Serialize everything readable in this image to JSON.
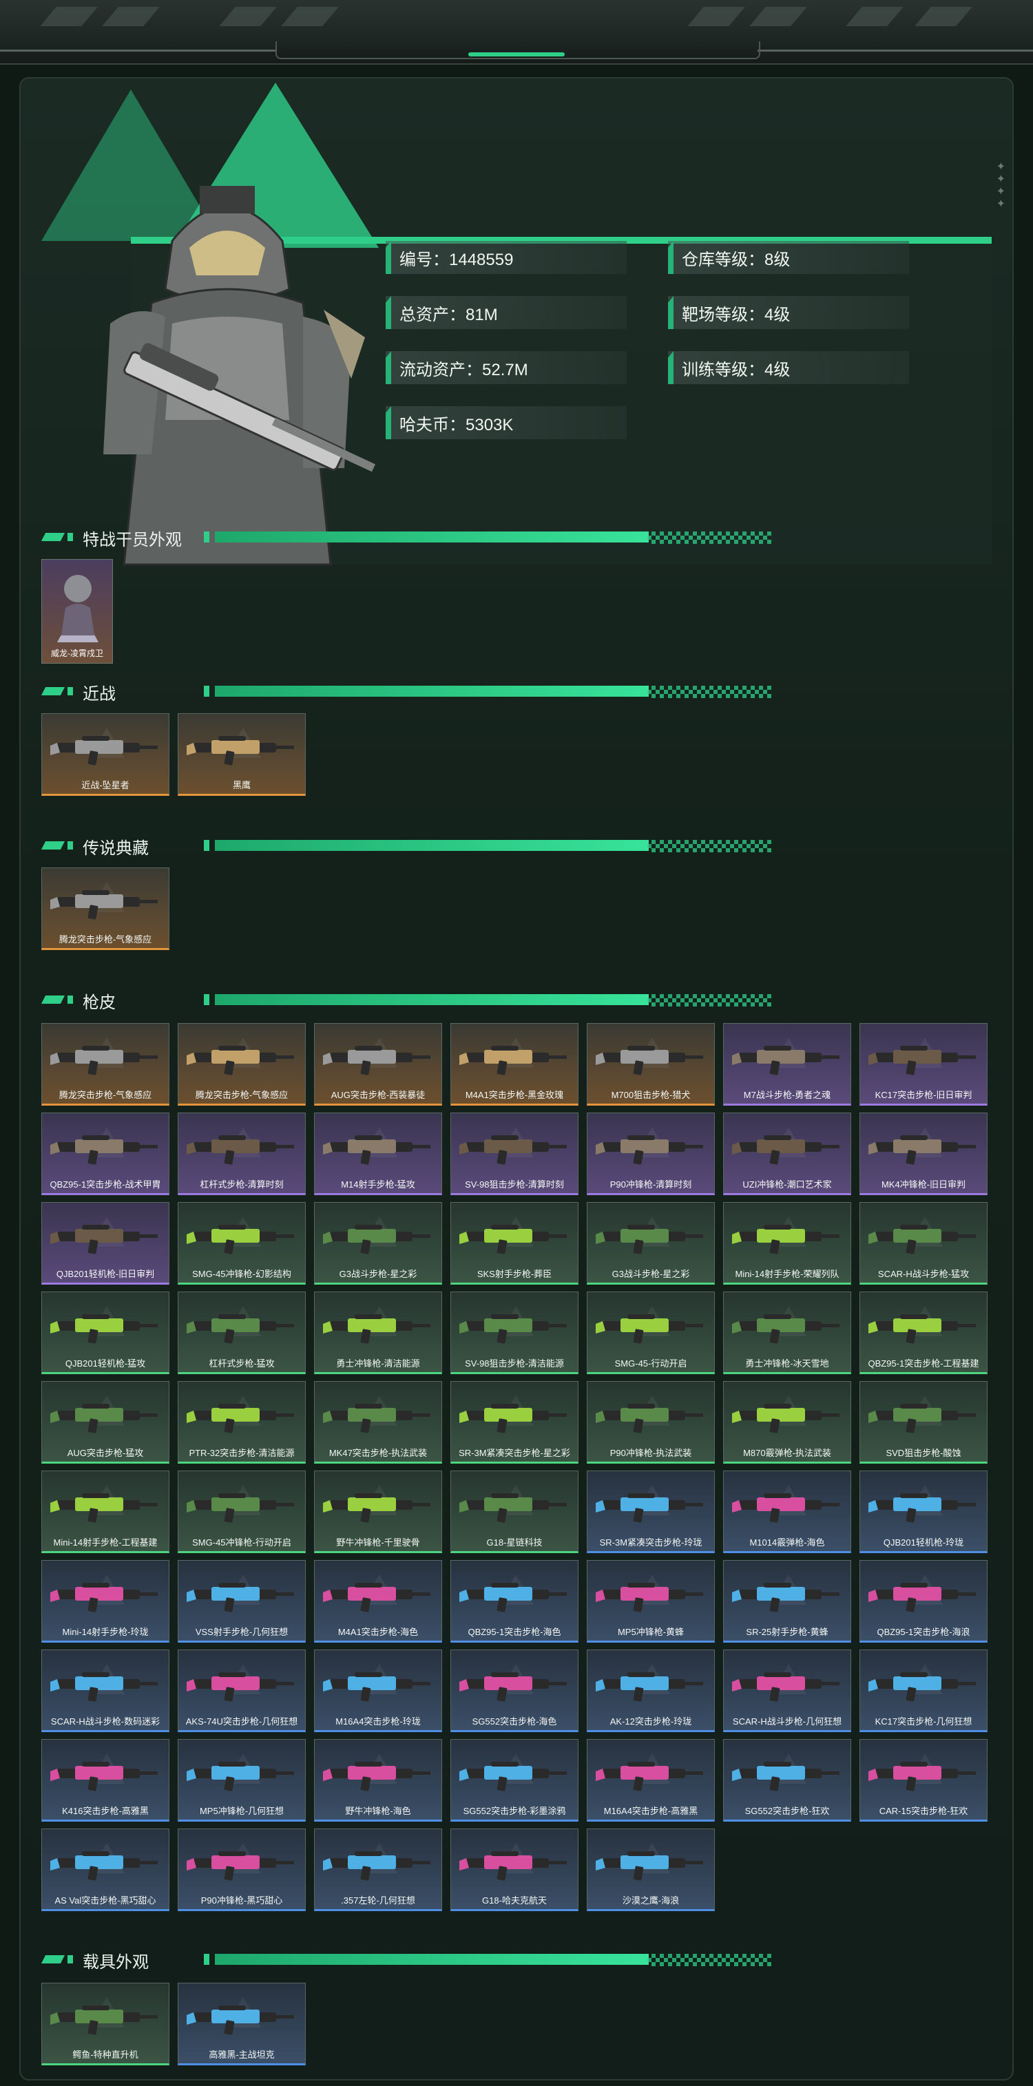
{
  "profile": {
    "stats": [
      {
        "label": "编号：1448559"
      },
      {
        "label": "仓库等级：8级"
      },
      {
        "label": "总资产：81M"
      },
      {
        "label": "靶场等级：4级"
      },
      {
        "label": "流动资产：52.7M"
      },
      {
        "label": "训练等级：4级"
      },
      {
        "label": "哈夫币：5303K"
      }
    ]
  },
  "sections": {
    "operator": {
      "title": "特战干员外观",
      "items": [
        {
          "name": "威龙-凌霄戍卫",
          "tier": "purple"
        }
      ]
    },
    "melee": {
      "title": "近战",
      "items": [
        {
          "name": "近战-坠星者",
          "tier": "gold"
        },
        {
          "name": "黑鹰",
          "tier": "gold"
        }
      ]
    },
    "legend": {
      "title": "传说典藏",
      "items": [
        {
          "name": "腾龙突击步枪-气象感应",
          "tier": "gold"
        }
      ]
    },
    "skins": {
      "title": "枪皮",
      "items": [
        {
          "name": "腾龙突击步枪-气象感应",
          "tier": "gold"
        },
        {
          "name": "腾龙突击步枪-气象感应",
          "tier": "gold"
        },
        {
          "name": "AUG突击步枪-西装暴徒",
          "tier": "gold"
        },
        {
          "name": "M4A1突击步枪-黑金玫瑰",
          "tier": "gold"
        },
        {
          "name": "M700狙击步枪-猎犬",
          "tier": "gold"
        },
        {
          "name": "M7战斗步枪-勇者之魂",
          "tier": "purple"
        },
        {
          "name": "KC17突击步枪-旧日审判",
          "tier": "purple"
        },
        {
          "name": "QBZ95-1突击步枪-战术甲胄",
          "tier": "purple"
        },
        {
          "name": "杠杆式步枪-清算时刻",
          "tier": "purple"
        },
        {
          "name": "M14射手步枪-猛攻",
          "tier": "purple"
        },
        {
          "name": "SV-98狙击步枪-清算时刻",
          "tier": "purple"
        },
        {
          "name": "P90冲锋枪-清算时刻",
          "tier": "purple"
        },
        {
          "name": "UZI冲锋枪-潮口艺术家",
          "tier": "purple"
        },
        {
          "name": "MK4冲锋枪-旧日审判",
          "tier": "purple"
        },
        {
          "name": "QJB201轻机枪-旧日审判",
          "tier": "purple"
        },
        {
          "name": "SMG-45冲锋枪-幻影结构",
          "tier": "green"
        },
        {
          "name": "G3战斗步枪-星之彩",
          "tier": "green"
        },
        {
          "name": "SKS射手步枪-葬臣",
          "tier": "green"
        },
        {
          "name": "G3战斗步枪-星之彩",
          "tier": "green"
        },
        {
          "name": "Mini-14射手步枪-荣耀列队",
          "tier": "green"
        },
        {
          "name": "SCAR-H战斗步枪-猛攻",
          "tier": "green"
        },
        {
          "name": "QJB201轻机枪-猛攻",
          "tier": "green"
        },
        {
          "name": "杠杆式步枪-猛攻",
          "tier": "green"
        },
        {
          "name": "勇士冲锋枪-清洁能源",
          "tier": "green"
        },
        {
          "name": "SV-98狙击步枪-清洁能源",
          "tier": "green"
        },
        {
          "name": "SMG-45-行动开启",
          "tier": "green"
        },
        {
          "name": "勇士冲锋枪-冰天雪地",
          "tier": "green"
        },
        {
          "name": "QBZ95-1突击步枪-工程基建",
          "tier": "green"
        },
        {
          "name": "AUG突击步枪-猛攻",
          "tier": "green"
        },
        {
          "name": "PTR-32突击步枪-清洁能源",
          "tier": "green"
        },
        {
          "name": "MK47突击步枪-执法武装",
          "tier": "green"
        },
        {
          "name": "SR-3M紧凑突击步枪-星之彩",
          "tier": "green"
        },
        {
          "name": "P90冲锋枪-执法武装",
          "tier": "green"
        },
        {
          "name": "M870霰弹枪-执法武装",
          "tier": "green"
        },
        {
          "name": "SVD狙击步枪-酸蚀",
          "tier": "green"
        },
        {
          "name": "Mini-14射手步枪-工程基建",
          "tier": "green"
        },
        {
          "name": "SMG-45冲锋枪-行动开启",
          "tier": "green"
        },
        {
          "name": "野牛冲锋枪-千里驶骨",
          "tier": "green"
        },
        {
          "name": "G18-星链科技",
          "tier": "green"
        },
        {
          "name": "SR-3M紧凑突击步枪-玲珑",
          "tier": "blue"
        },
        {
          "name": "M1014霰弹枪-海色",
          "tier": "blue"
        },
        {
          "name": "QJB201轻机枪-玲珑",
          "tier": "blue"
        },
        {
          "name": "Mini-14射手步枪-玲珑",
          "tier": "blue"
        },
        {
          "name": "VSS射手步枪-几何狂想",
          "tier": "blue"
        },
        {
          "name": "M4A1突击步枪-海色",
          "tier": "blue"
        },
        {
          "name": "QBZ95-1突击步枪-海色",
          "tier": "blue"
        },
        {
          "name": "MP5冲锋枪-黄蜂",
          "tier": "blue"
        },
        {
          "name": "SR-25射手步枪-黄蜂",
          "tier": "blue"
        },
        {
          "name": "QBZ95-1突击步枪-海浪",
          "tier": "blue"
        },
        {
          "name": "SCAR-H战斗步枪-数码迷彩",
          "tier": "blue"
        },
        {
          "name": "AKS-74U突击步枪-几何狂想",
          "tier": "blue"
        },
        {
          "name": "M16A4突击步枪-玲珑",
          "tier": "blue"
        },
        {
          "name": "SG552突击步枪-海色",
          "tier": "blue"
        },
        {
          "name": "AK-12突击步枪-玲珑",
          "tier": "blue"
        },
        {
          "name": "SCAR-H战斗步枪-几何狂想",
          "tier": "blue"
        },
        {
          "name": "KC17突击步枪-几何狂想",
          "tier": "blue"
        },
        {
          "name": "K416突击步枪-高雅黑",
          "tier": "blue"
        },
        {
          "name": "MP5冲锋枪-几何狂想",
          "tier": "blue"
        },
        {
          "name": "野牛冲锋枪-海色",
          "tier": "blue"
        },
        {
          "name": "SG552突击步枪-彩墨涂鸦",
          "tier": "blue"
        },
        {
          "name": "M16A4突击步枪-高雅黑",
          "tier": "blue"
        },
        {
          "name": "SG552突击步枪-狂欢",
          "tier": "blue"
        },
        {
          "name": "CAR-15突击步枪-狂欢",
          "tier": "blue"
        },
        {
          "name": "AS Val突击步枪-黑巧甜心",
          "tier": "blue"
        },
        {
          "name": "P90冲锋枪-黑巧甜心",
          "tier": "blue"
        },
        {
          "name": ".357左轮-几何狂想",
          "tier": "blue"
        },
        {
          "name": "G18-哈夫克航天",
          "tier": "blue"
        },
        {
          "name": "沙漠之鹰-海浪",
          "tier": "blue"
        }
      ]
    },
    "vehicles": {
      "title": "载具外观",
      "items": [
        {
          "name": "鳄鱼-特种直升机",
          "tier": "green"
        },
        {
          "name": "高雅黑-主战坦克",
          "tier": "blue"
        }
      ]
    }
  },
  "colors": {
    "accent": "#2fcf8a",
    "gold": "#e3943c",
    "purple": "#9d7ae0",
    "green": "#4cd67f",
    "blue": "#4f8fe6"
  }
}
